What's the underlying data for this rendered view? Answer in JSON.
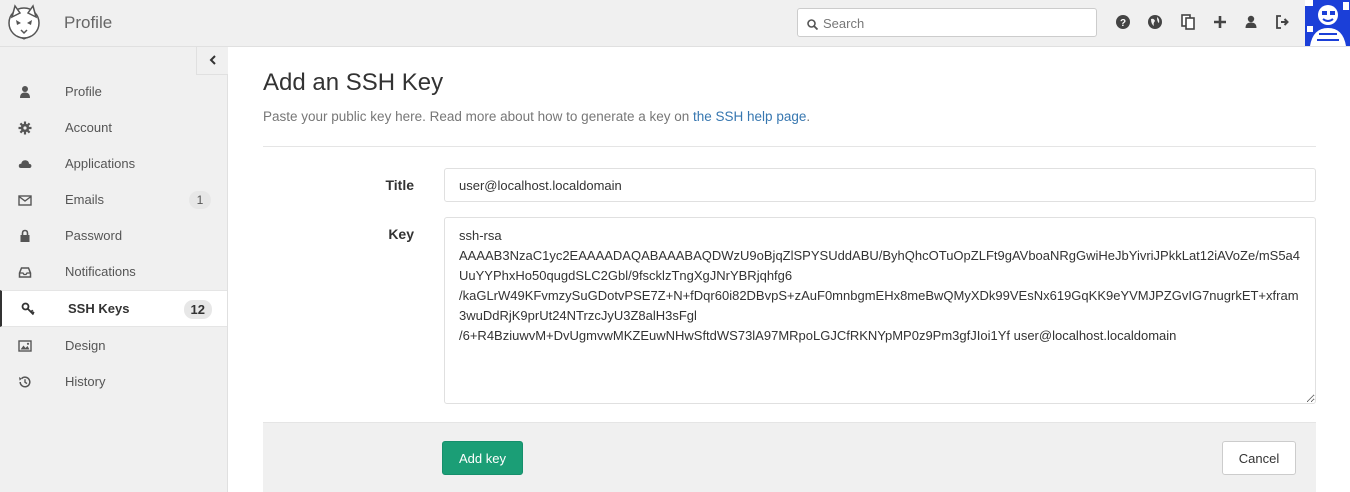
{
  "header": {
    "title": "Profile",
    "search_placeholder": "Search",
    "icons": [
      "help-icon",
      "globe-icon",
      "snippets-icon",
      "plus-icon",
      "user-icon",
      "sign-out-icon"
    ]
  },
  "sidebar": {
    "items": [
      {
        "label": "Profile",
        "icon": "user-icon"
      },
      {
        "label": "Account",
        "icon": "gear-icon"
      },
      {
        "label": "Applications",
        "icon": "cloud-icon"
      },
      {
        "label": "Emails",
        "icon": "envelope-icon",
        "badge": "1"
      },
      {
        "label": "Password",
        "icon": "lock-icon"
      },
      {
        "label": "Notifications",
        "icon": "inbox-icon"
      },
      {
        "label": "SSH Keys",
        "icon": "key-icon",
        "badge": "12",
        "active": true
      },
      {
        "label": "Design",
        "icon": "image-icon"
      },
      {
        "label": "History",
        "icon": "history-icon"
      }
    ]
  },
  "main": {
    "title": "Add an SSH Key",
    "description_prefix": "Paste your public key here. Read more about how to generate a key on ",
    "description_link": "the SSH help page",
    "description_suffix": ".",
    "title_label": "Title",
    "title_value": "user@localhost.localdomain",
    "key_label": "Key",
    "key_value": "ssh-rsa\nAAAAB3NzaC1yc2EAAAADAQABAAABAQDWzU9oBjqZlSPYSUddABU/ByhQhcOTuOpZLFt9gAVboaNRgGwiHeJbYivriJPkkLat12iAVoZe/mS5a4UuYYPhxHo50qugdSLC2Gbl/9fscklzTngXgJNrYBRjqhfg6\n/kaGLrW49KFvmzySuGDotvPSE7Z+N+fDqr60i82DBvpS+zAuF0mnbgmEHx8meBwQMyXDk99VEsNx619GqKK9eYVMJPZGvIG7nugrkET+xfram3wuDdRjK9prUt24NTrzcJyU3Z8alH3sFgl\n/6+R4BziuwvM+DvUgmvwMKZEuwNHwSftdWS73lA97MRpoLGJCfRKNYpMP0z9Pm3gfJIoi1Yf user@localhost.localdomain",
    "add_button": "Add key",
    "cancel_button": "Cancel"
  },
  "colors": {
    "accent": "#1b9e76",
    "link": "#3777b0",
    "avatar_bg": "#1b3fd8"
  }
}
